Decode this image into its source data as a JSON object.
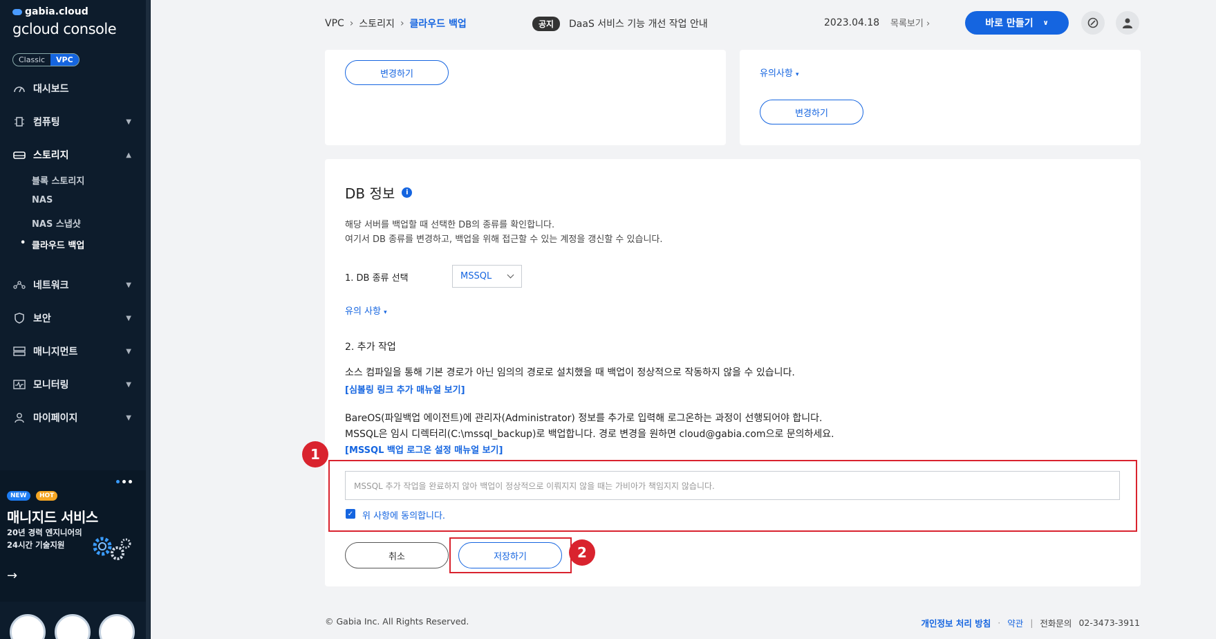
{
  "sidebar": {
    "brand_small": "gabia.cloud",
    "brand_big": "gcloud console",
    "toggle": {
      "classic": "Classic",
      "vpc": "VPC"
    },
    "items": [
      {
        "label": "대시보드",
        "icon": "dashboard-icon"
      },
      {
        "label": "컴퓨팅",
        "icon": "chip-icon"
      },
      {
        "label": "스토리지",
        "icon": "storage-icon"
      },
      {
        "label": "네트워크",
        "icon": "network-icon"
      },
      {
        "label": "보안",
        "icon": "shield-icon"
      },
      {
        "label": "매니지먼트",
        "icon": "management-icon"
      },
      {
        "label": "모니터링",
        "icon": "monitor-icon"
      },
      {
        "label": "마이페이지",
        "icon": "user-icon"
      }
    ],
    "storage_sub": [
      "블록 스토리지",
      "NAS",
      "NAS 스냅샷",
      "클라우드 백업"
    ],
    "promo": {
      "new": "NEW",
      "hot": "HOT",
      "title": "매니지드 서비스",
      "line1": "20년 경력 엔지니어의",
      "line2": "24시간 기술지원"
    }
  },
  "header": {
    "breadcrumb": [
      "VPC",
      "스토리지",
      "클라우드 백업"
    ],
    "notice_tag": "공지",
    "notice_text": "DaaS 서비스 기능 개선 작업 안내",
    "notice_date": "2023.04.18",
    "list_link": "목록보기",
    "create_button": "바로 만들기"
  },
  "top_cards": {
    "left_button": "변경하기",
    "right_caution": "유의사항",
    "right_button": "변경하기"
  },
  "db_section": {
    "title": "DB 정보",
    "desc1": "해당 서버를 백업할 때 선택한 DB의 종류를 확인합니다.",
    "desc2": "여기서 DB 종류를 변경하고, 백업을 위해 접근할 수 있는 계정을 갱신할 수 있습니다.",
    "step1_label": "1. DB 종류 선택",
    "db_type": "MSSQL",
    "caution": "유의 사항",
    "step2_label": "2. 추가 작업",
    "step2_desc": "소스 컴파일을 통해 기본 경로가 아닌 임의의 경로로 설치했을 때 백업이 정상적으로 작동하지 않을 수 있습니다.",
    "symlink_link": "[심볼링 링크 추가 매뉴얼 보기]",
    "bareos_desc": "BareOS(파일백업 에이전트)에 관리자(Administrator) 정보를 추가로 입력해 로그온하는 과정이 선행되어야 합니다.",
    "mssql_desc": "MSSQL은 임시 디렉터리(C:\\mssql_backup)로 백업합니다. 경로 변경을 원하면 cloud@gabia.com으로 문의하세요.",
    "mssql_link": "[MSSQL 백업 로그온 설정 매뉴얼 보기]",
    "agree_placeholder": "MSSQL 추가 작업을 완료하지 않아 백업이 정상적으로 이뤄지지 않을 때는 가비아가 책임지지 않습니다.",
    "agree_label": "위 사항에 동의합니다.",
    "cancel_button": "취소",
    "save_button": "저장하기"
  },
  "annotations": {
    "one": "1",
    "two": "2"
  },
  "footer": {
    "copyright": "© Gabia Inc. All Rights Reserved.",
    "privacy": "개인정보 처리 방침",
    "terms": "약관",
    "contact_label": "전화문의",
    "contact_number": "02-3473-3911"
  },
  "colors": {
    "accent": "#1565e0",
    "sidebar_bg": "#0d1c2c",
    "annotation_red": "#d9232e"
  }
}
